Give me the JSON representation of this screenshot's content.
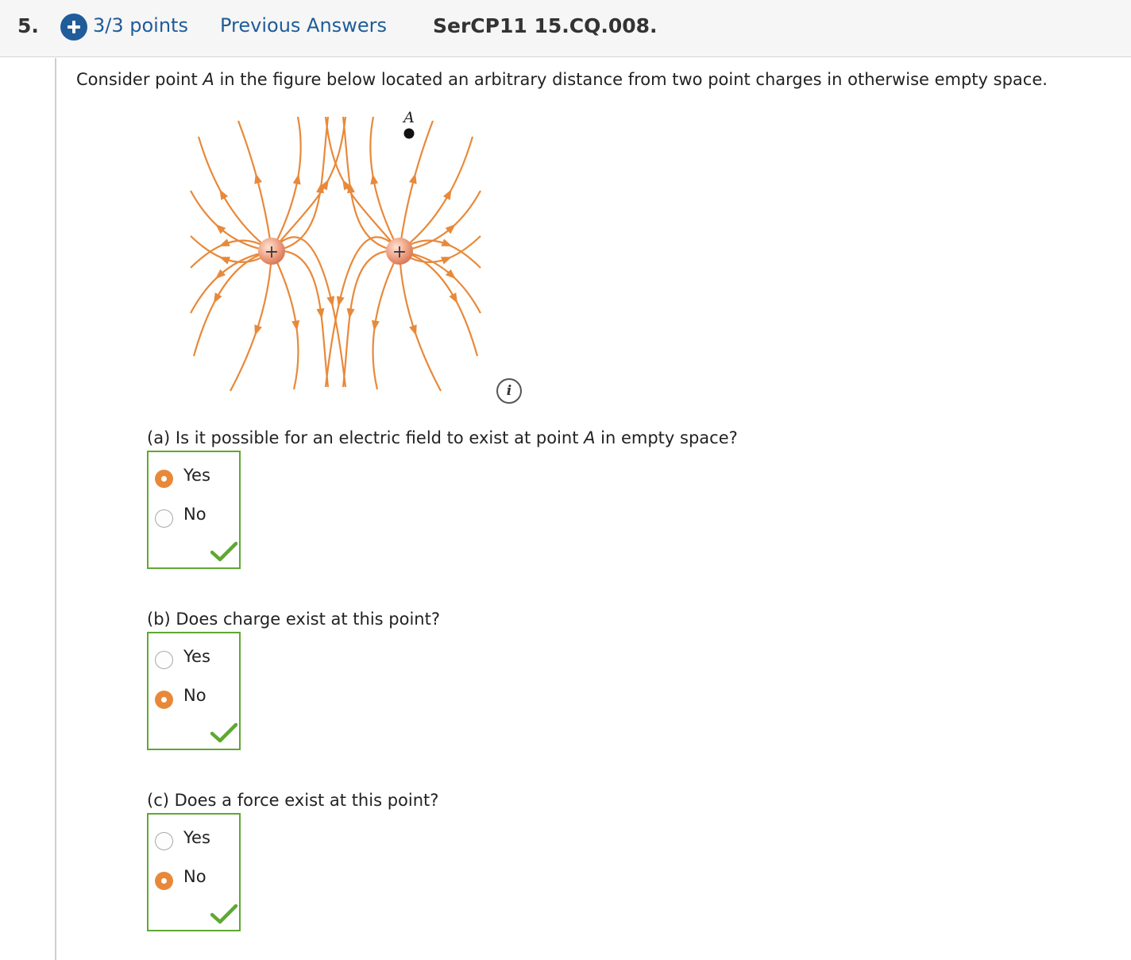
{
  "header": {
    "question_number": "5.",
    "points": "3/3 points",
    "previous_answers": "Previous Answers",
    "question_id": "SerCP11 15.CQ.008."
  },
  "prompt": {
    "before": "Consider point ",
    "point": "A",
    "after": " in the figure below located an arbitrary distance from two point charges in otherwise empty space."
  },
  "figure": {
    "point_label": "A",
    "charge_symbol": "+",
    "field_color": "#e8893a",
    "info_icon": "i"
  },
  "parts": [
    {
      "question": "(a) Is it possible for an electric field to exist at point ",
      "point": "A",
      "question_end": " in empty space?",
      "options": [
        "Yes",
        "No"
      ],
      "selected": "Yes",
      "correct": true
    },
    {
      "question": "(b) Does charge exist at this point?",
      "options": [
        "Yes",
        "No"
      ],
      "selected": "No",
      "correct": true
    },
    {
      "question": "(c) Does a force exist at this point?",
      "options": [
        "Yes",
        "No"
      ],
      "selected": "No",
      "correct": true
    }
  ],
  "colors": {
    "accent_blue": "#1f5c99",
    "correct_green": "#5fa832",
    "selected_orange": "#e8893a"
  }
}
